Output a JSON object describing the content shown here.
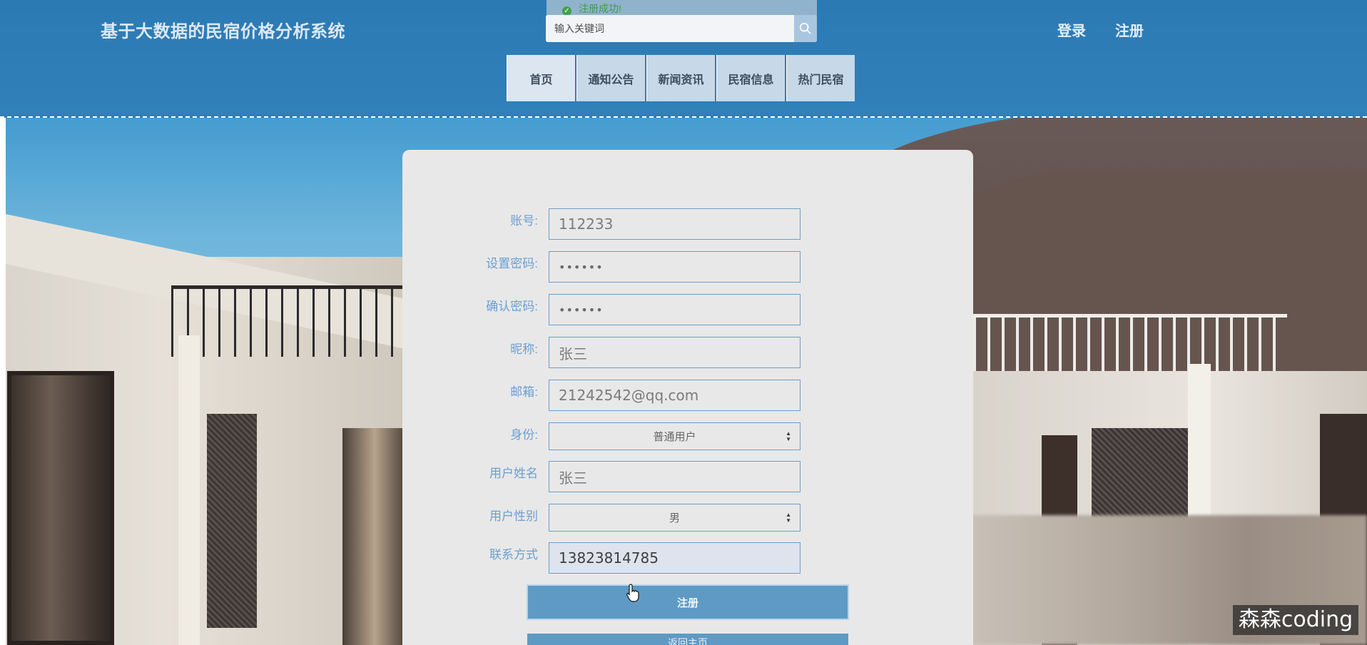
{
  "header": {
    "site_title": "基于大数据的民宿价格分析系统",
    "toast": "注册成功!",
    "search_placeholder": "输入关键词",
    "login": "登录",
    "register": "注册"
  },
  "nav": {
    "items": [
      "首页",
      "通知公告",
      "新闻资讯",
      "民宿信息",
      "热门民宿"
    ],
    "active": "首页"
  },
  "form": {
    "account": {
      "label": "账号:",
      "value": "112233"
    },
    "password": {
      "label": "设置密码:",
      "value": "••••••"
    },
    "confirm_password": {
      "label": "确认密码:",
      "value": "••••••"
    },
    "nickname": {
      "label": "昵称:",
      "value": "张三"
    },
    "email": {
      "label": "邮箱:",
      "value": "21242542@qq.com"
    },
    "role": {
      "label": "身份:",
      "value": "普通用户"
    },
    "real_name": {
      "label": "用户姓名",
      "value": "张三"
    },
    "gender": {
      "label": "用户性别",
      "value": "男"
    },
    "phone": {
      "label": "联系方式",
      "value": "13823814785"
    },
    "submit": "注册",
    "back": "返回主页"
  },
  "watermark": "森森coding",
  "colors": {
    "header_bg": "#2c7ab4",
    "button_bg": "#5e9ac4",
    "label_text": "#6b9fd0",
    "card_bg": "#e8e8e8"
  }
}
